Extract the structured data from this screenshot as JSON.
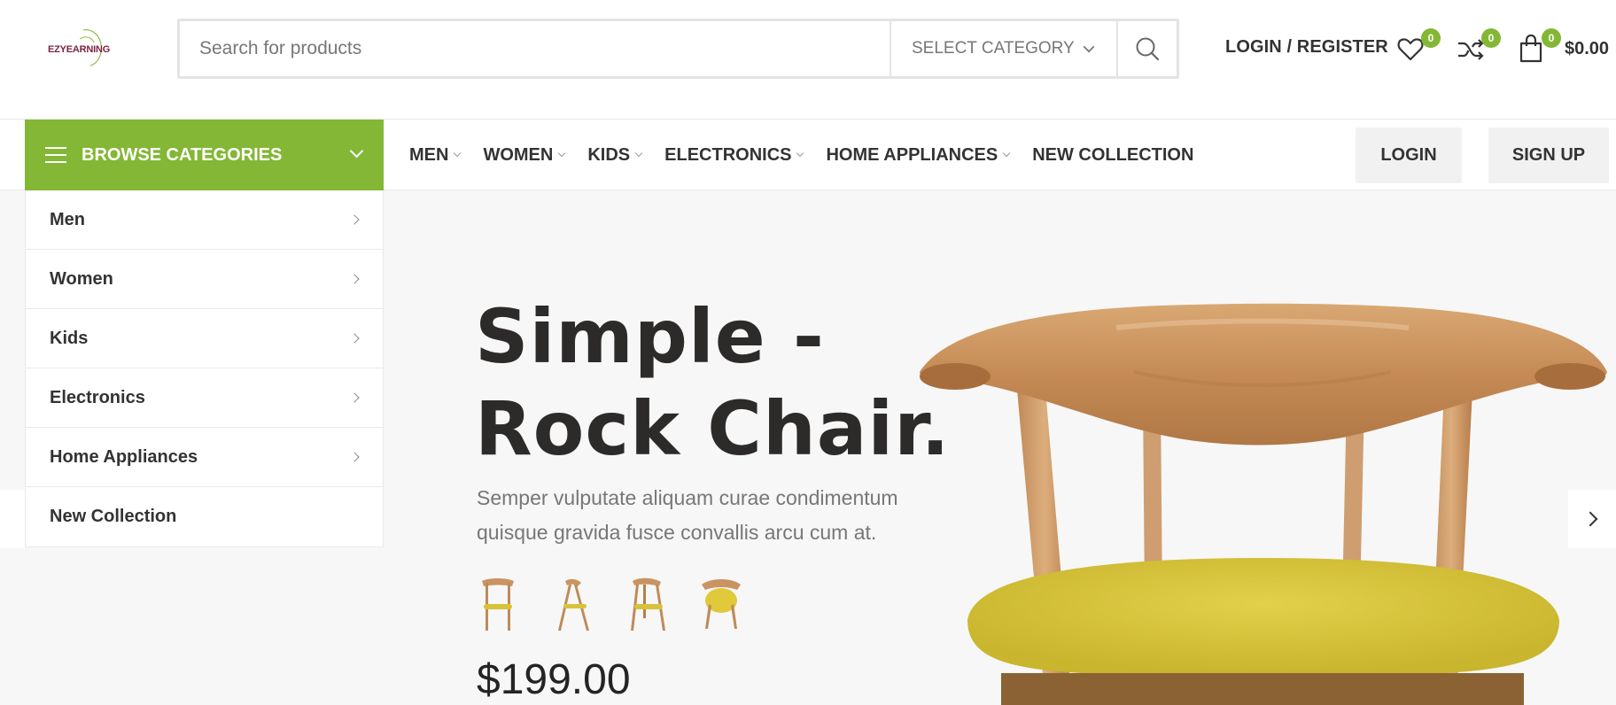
{
  "header": {
    "logo_text": "EZYEARNING",
    "logo_subtext": "",
    "search_placeholder": "Search for products",
    "select_category": "SELECT CATEGORY",
    "login_register": "LOGIN / REGISTER",
    "wishlist_count": "0",
    "compare_count": "0",
    "cart_count": "0",
    "cart_total": "$0.00"
  },
  "nav": {
    "browse_label": "BROWSE CATEGORIES",
    "menu": [
      {
        "label": "MEN",
        "has_dropdown": true
      },
      {
        "label": "WOMEN",
        "has_dropdown": true
      },
      {
        "label": "KIDS",
        "has_dropdown": true
      },
      {
        "label": "ELECTRONICS",
        "has_dropdown": true
      },
      {
        "label": "HOME APPLIANCES",
        "has_dropdown": true
      },
      {
        "label": "NEW COLLECTION",
        "has_dropdown": false
      }
    ],
    "login_label": "LOGIN",
    "signup_label": "SIGN UP"
  },
  "categories": [
    {
      "label": "Men",
      "has_arrow": true
    },
    {
      "label": "Women",
      "has_arrow": true
    },
    {
      "label": "Kids",
      "has_arrow": true
    },
    {
      "label": "Electronics",
      "has_arrow": true
    },
    {
      "label": "Home Appliances",
      "has_arrow": true
    },
    {
      "label": "New Collection",
      "has_arrow": false
    }
  ],
  "hero": {
    "title_line1": "Simple -",
    "title_line2": "Rock Chair.",
    "description": "Semper vulputate aliquam curae condimentum quisque gravida fusce convallis arcu cum at.",
    "price": "$199.00"
  },
  "colors": {
    "accent": "#83b735",
    "text_dark": "#333333",
    "muted": "#777777",
    "hero_bg": "#f7f7f7"
  },
  "icons": {
    "search": "search-icon",
    "wishlist": "heart-icon",
    "compare": "shuffle-icon",
    "cart": "shopping-bag-icon",
    "menu": "hamburger-icon"
  }
}
